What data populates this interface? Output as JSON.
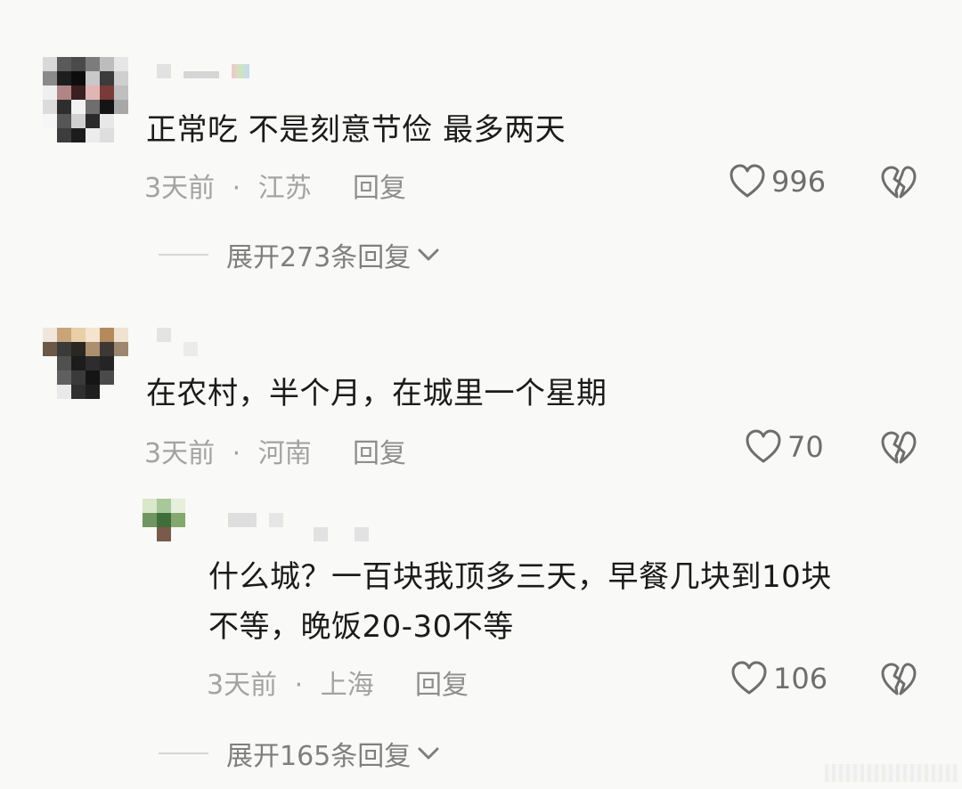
{
  "comments": [
    {
      "text": "正常吃 不是刻意节俭 最多两天",
      "time": "3天前",
      "location": "江苏",
      "reply_label": "回复",
      "likes": "996",
      "expand_label": "展开273条回复"
    },
    {
      "text": "在农村，半个月，在城里一个星期",
      "time": "3天前",
      "location": "河南",
      "reply_label": "回复",
      "likes": "70",
      "reply": {
        "text_line1": "什么城？一百块我顶多三天，早餐几块到10块",
        "text_line2": "不等，晚饭20-30不等",
        "time": "3天前",
        "location": "上海",
        "reply_label": "回复",
        "likes": "106"
      },
      "expand_label": "展开165条回复"
    }
  ],
  "separator": "·",
  "colors": {
    "background": "#f9f9f7",
    "text": "#1b1b1b",
    "meta": "#a3a3a3",
    "icon": "#6e6e6e"
  },
  "icons": {
    "like": "heart-outline-icon",
    "dislike": "broken-heart-icon",
    "expand": "chevron-down-icon"
  }
}
